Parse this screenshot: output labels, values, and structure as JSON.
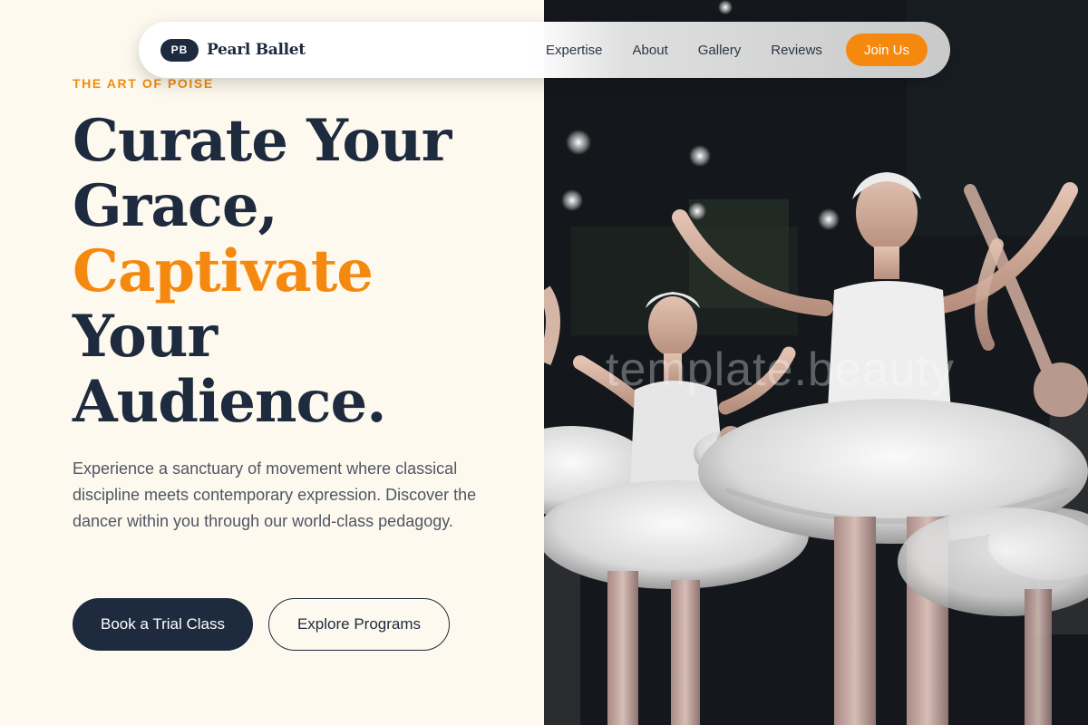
{
  "brand": {
    "badge": "PB",
    "name": "Pearl Ballet"
  },
  "nav": {
    "links": [
      "Expertise",
      "About",
      "Gallery",
      "Reviews"
    ],
    "cta": "Join Us"
  },
  "hero": {
    "eyebrow": "THE ART OF POISE",
    "headline": {
      "line1": "Curate Your",
      "line2": "Grace,",
      "line3_accent": "Captivate",
      "line4": "Your",
      "line5": "Audience."
    },
    "lede": "Experience a sanctuary of movement where classical discipline meets contemporary expression. Discover the dancer within you through our world-class pedagogy.",
    "primary_cta": "Book a Trial Class",
    "secondary_cta": "Explore Programs",
    "watermark": "template.beauty"
  },
  "colors": {
    "navy": "#1e2a3e",
    "accent": "#f5890f",
    "cream": "#fdf9ee"
  }
}
